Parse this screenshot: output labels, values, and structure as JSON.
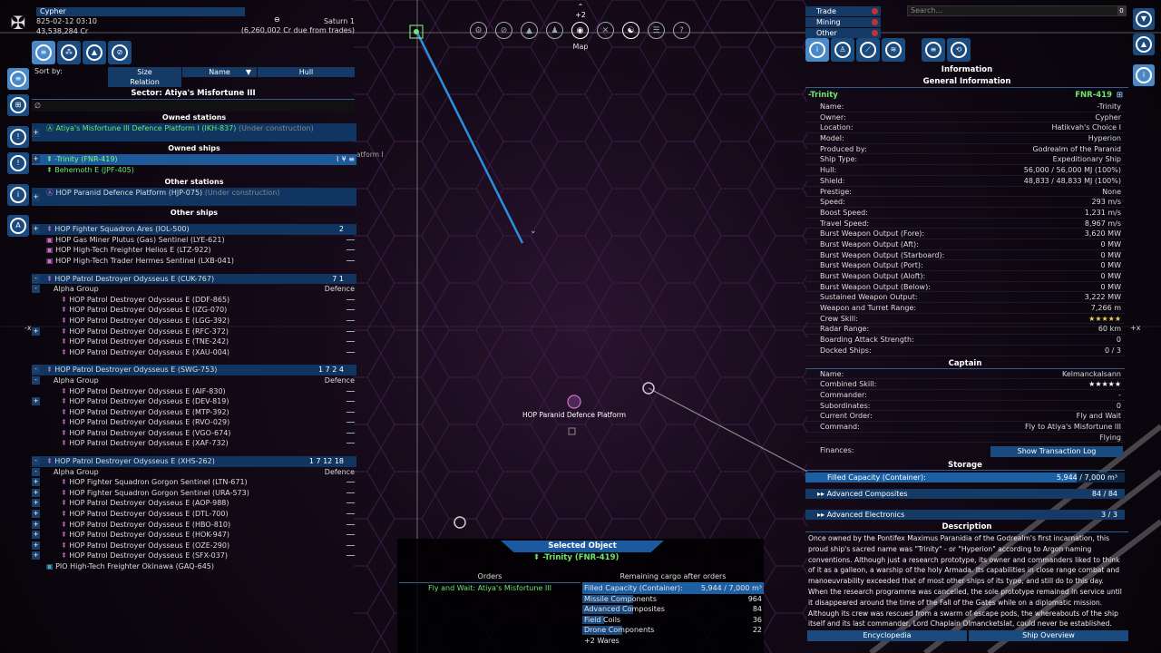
{
  "player": {
    "name": "Cypher",
    "date": "825-02-12 03:10",
    "credits": "43,538,284 Cr",
    "location": "Saturn 1",
    "due": "(6,260,002 Cr due from trades)"
  },
  "left": {
    "sort_label": "Sort by:",
    "sort_size": "Size",
    "sort_name": "Name",
    "sort_hull": "Hull",
    "sort_relation": "Relation",
    "sector_title": "Sector: Atiya's Misfortune III",
    "filter_symbol": "∅",
    "owned_stations_title": "Owned stations",
    "owned_station": "Atiya's Misfortune III Defence Platform I (IKH-837)",
    "owned_station_status": "(Under construction)",
    "owned_ships_title": "Owned ships",
    "owned_ship_1": "-Trinity (FNR-419)",
    "owned_ship_2": "Behemoth E (JPF-405)",
    "other_stations_title": "Other stations",
    "other_station": "HOP Paranid Defence Platform (HJP-075)",
    "other_station_status": "(Under construction)",
    "other_ships_title": "Other ships",
    "ships": [
      {
        "name": "HOP Fighter Squadron Ares (IOL-500)",
        "right": "2"
      },
      {
        "name": "HOP Gas Miner Plutus (Gas) Sentinel (LYE-621)",
        "right": ""
      },
      {
        "name": "HOP High-Tech Freighter Helios E (LTZ-922)",
        "right": ""
      },
      {
        "name": "HOP High-Tech Trader Hermes Sentinel (LXB-041)",
        "right": ""
      }
    ],
    "fleet1": {
      "name": "HOP Patrol Destroyer Odysseus E (CUK-767)",
      "counts": "7  1",
      "group": "Alpha Group",
      "role": "Defence",
      "members": [
        "HOP Patrol Destroyer Odysseus E (DDF-865)",
        "HOP Patrol Destroyer Odysseus E (IZG-070)",
        "HOP Patrol Destroyer Odysseus E (LGG-392)",
        "HOP Patrol Destroyer Odysseus E (RFC-372)",
        "HOP Patrol Destroyer Odysseus E (TNE-242)",
        "HOP Patrol Destroyer Odysseus E (XAU-004)"
      ]
    },
    "fleet2": {
      "name": "HOP Patrol Destroyer Odysseus E (SWG-753)",
      "counts": "1  7  2  4",
      "group": "Alpha Group",
      "role": "Defence",
      "members": [
        "HOP Patrol Destroyer Odysseus E (AIF-830)",
        "HOP Patrol Destroyer Odysseus E (DEV-819)",
        "HOP Patrol Destroyer Odysseus E (MTP-392)",
        "HOP Patrol Destroyer Odysseus E (RVO-029)",
        "HOP Patrol Destroyer Odysseus E (VGO-674)",
        "HOP Patrol Destroyer Odysseus E (XAF-732)"
      ]
    },
    "fleet3": {
      "name": "HOP Patrol Destroyer Odysseus E (XHS-262)",
      "counts": "1  7 12 18",
      "group": "Alpha Group",
      "role": "Defence",
      "members": [
        "HOP Fighter Squadron Gorgon Sentinel (LTN-671)",
        "HOP Fighter Squadron Gorgon Sentinel (URA-573)",
        "HOP Patrol Destroyer Odysseus E (AOP-988)",
        "HOP Patrol Destroyer Odysseus E (DTL-700)",
        "HOP Patrol Destroyer Odysseus E (HBO-810)",
        "HOP Patrol Destroyer Odysseus E (HOK-947)",
        "HOP Patrol Destroyer Odysseus E (OZE-290)",
        "HOP Patrol Destroyer Odysseus E (SFX-037)"
      ]
    },
    "last_ship": "PIO High-Tech Freighter Okinawa (GAQ-645)"
  },
  "map": {
    "label": "Map",
    "zoom_indicator": "+2",
    "station_label": "HOP Paranid Defence Platform",
    "ghost_label": "atform I",
    "axis_left": "-x",
    "axis_right": "+x"
  },
  "right": {
    "filters": [
      "Trade",
      "Mining",
      "Other"
    ],
    "search_placeholder": "Search...",
    "search_toggle": "0",
    "info_title": "Information",
    "general_title": "General Information",
    "ship_name": "-Trinity",
    "ship_code": "FNR-419",
    "rows": [
      {
        "k": "Name:",
        "v": "-Trinity"
      },
      {
        "k": "Owner:",
        "v": "Cypher"
      },
      {
        "k": "Location:",
        "v": "Hatikvah's Choice I"
      },
      {
        "k": "Model:",
        "v": "Hyperion"
      },
      {
        "k": "Produced by:",
        "v": "Godrealm of the Paranid"
      },
      {
        "k": "Ship Type:",
        "v": "Expeditionary Ship"
      },
      {
        "k": "Hull:",
        "v": "56,000 / 56,000 MJ (100%)"
      },
      {
        "k": "Shield:",
        "v": "48,833 / 48,833 MJ (100%)"
      },
      {
        "k": "Prestige:",
        "v": "None"
      },
      {
        "k": "Speed:",
        "v": "293 m/s"
      },
      {
        "k": "Boost Speed:",
        "v": "1,231 m/s"
      },
      {
        "k": "Travel Speed:",
        "v": "8,967 m/s"
      },
      {
        "k": "Burst Weapon Output (Fore):",
        "v": "3,620 MW"
      },
      {
        "k": "Burst Weapon Output (Aft):",
        "v": "0 MW"
      },
      {
        "k": "Burst Weapon Output (Starboard):",
        "v": "0 MW"
      },
      {
        "k": "Burst Weapon Output (Port):",
        "v": "0 MW"
      },
      {
        "k": "Burst Weapon Output (Aloft):",
        "v": "0 MW"
      },
      {
        "k": "Burst Weapon Output (Below):",
        "v": "0 MW"
      },
      {
        "k": "Sustained Weapon Output:",
        "v": "3,222 MW"
      },
      {
        "k": "Weapon and Turret Range:",
        "v": "7,266 m"
      },
      {
        "k": "Crew Skill:",
        "v": "★★★★★"
      },
      {
        "k": "Radar Range:",
        "v": "60 km"
      },
      {
        "k": "Boarding Attack Strength:",
        "v": "0"
      },
      {
        "k": "Docked Ships:",
        "v": "0 / 3"
      }
    ],
    "captain_title": "Captain",
    "captain_rows": [
      {
        "k": "Name:",
        "v": "Kelmanckalsann"
      },
      {
        "k": "Combined Skill:",
        "v": "★★★★★"
      },
      {
        "k": "Commander:",
        "v": "-"
      },
      {
        "k": "Subordinates:",
        "v": "0"
      },
      {
        "k": "Current Order:",
        "v": "Fly and Wait"
      },
      {
        "k": "  Command:",
        "v": "Fly to Atiya's Misfortune III"
      },
      {
        "k": "",
        "v": "Flying"
      }
    ],
    "finances_label": "Finances:",
    "transaction_btn": "Show Transaction Log",
    "storage_title": "Storage",
    "filled_label": "Filled Capacity (Container):",
    "filled_value": "5,944 / 7,000 m³",
    "filled_fraction": 0.849,
    "storage_rows": [
      {
        "k": "Advanced Composites",
        "v": "84 / 84"
      },
      {
        "k": "Advanced Electronics",
        "v": "3 / 3"
      }
    ],
    "desc_title": "Description",
    "description": "Once owned by the Pontifex Maximus Paranidia of the Godrealm's first incarnation, this proud ship's sacred name was \"Trinity\" - or \"Hyperion\" according to Argon naming conventions. Although just a research prototype, its owner and commanders liked to think of it as a galleon, a warship of the holy Armada. Its capabilities in close range combat and manoeuvrability exceeded that of most other ships of its type, and still do to this day. When the research programme was cancelled, the sole prototype remained in service until it disappeared around the time of the Fall of the Gates while on a diplomatic mission. Although its crew was rescued from a swarm of escape pods, the whereabouts of the ship itself and its last commander, Lord Chaplain Olmancketslat, could never be established.",
    "encyclopedia_btn": "Encyclopedia",
    "overview_btn": "Ship Overview"
  },
  "bottom": {
    "selected_title": "Selected Object",
    "selected_name": "-Trinity (FNR-419)",
    "orders_title": "Orders",
    "cargo_title": "Remaining cargo after orders",
    "order_1": "Fly and Wait: Atiya's Misfortune III",
    "cargo": [
      {
        "k": "Filled Capacity (Container):",
        "v": "5,944 / 7,000 m³"
      },
      {
        "k": "Missile Components",
        "v": "964"
      },
      {
        "k": "Advanced Composites",
        "v": "84"
      },
      {
        "k": "Field Coils",
        "v": "36"
      },
      {
        "k": "Drone Components",
        "v": "22"
      },
      {
        "k": "+2 Wares",
        "v": ""
      }
    ]
  },
  "colors": {
    "accent": "#1b4a7e",
    "selected": "#1e5a9a",
    "green": "#6be86b",
    "pink": "#d070d0"
  }
}
